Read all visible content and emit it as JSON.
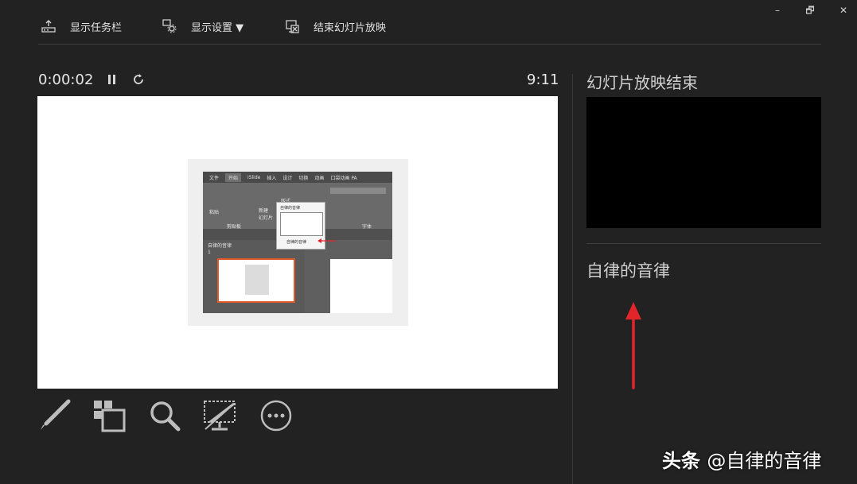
{
  "window_controls": {
    "minimize": "–",
    "restore": "🗗",
    "close": "✕"
  },
  "toolbar": {
    "show_taskbar": "显示任务栏",
    "display_settings": "显示设置 ▼",
    "end_slideshow": "结束幻灯片放映"
  },
  "timer": {
    "elapsed": "0:00:02",
    "clock": "9:11"
  },
  "slide": {
    "ribbon_tabs": [
      "文件",
      "开始",
      "iSlide",
      "插入",
      "设计",
      "切换",
      "动画",
      "口袋动画 PA"
    ],
    "section_label": "自律的音律",
    "thumb_number": "1",
    "popup_title": "自律的音律",
    "popup_caption": "自律的音律",
    "ribbon_labels": {
      "paste": "粘贴",
      "new_slide": "新建\n幻灯片",
      "clipboard": "剪贴板",
      "font_group": "字体",
      "layout": "版式"
    }
  },
  "right_panel": {
    "next_label": "幻灯片放映结束",
    "notes": "自律的音律"
  },
  "watermark": {
    "brand": "头条",
    "handle": "@自律的音律"
  },
  "colors": {
    "background": "#222222",
    "arrow": "#e0262b",
    "thumb_border": "#e05a2a"
  },
  "icons": {
    "taskbar": "taskbar-icon",
    "settings": "display-settings-icon",
    "end": "end-show-icon",
    "pause": "pause-icon",
    "restart": "restart-icon",
    "pen": "pen-icon",
    "see_all": "see-all-slides-icon",
    "zoom": "zoom-icon",
    "black_screen": "black-screen-icon",
    "more": "more-options-icon"
  }
}
